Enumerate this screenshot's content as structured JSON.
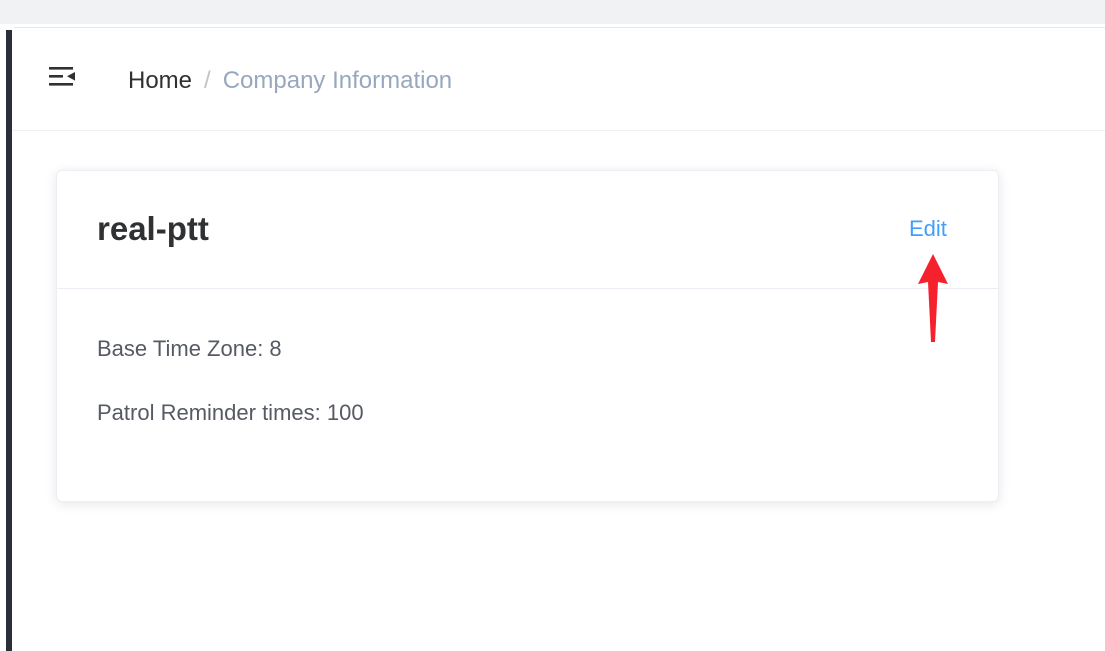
{
  "breadcrumb": {
    "home": "Home",
    "separator": "/",
    "current": "Company Information"
  },
  "card": {
    "title": "real-ptt",
    "edit_label": "Edit",
    "base_time_zone": "Base Time Zone: 8",
    "patrol_reminder": "Patrol Reminder times: 100"
  },
  "icons": {
    "menu": "hamburger-fold-icon",
    "annotation": "red-arrow-icon"
  },
  "colors": {
    "accent": "#409eff",
    "breadcrumb_current": "#97a8be",
    "annotation": "#f5222d",
    "sidebar": "#2b2f3a"
  }
}
